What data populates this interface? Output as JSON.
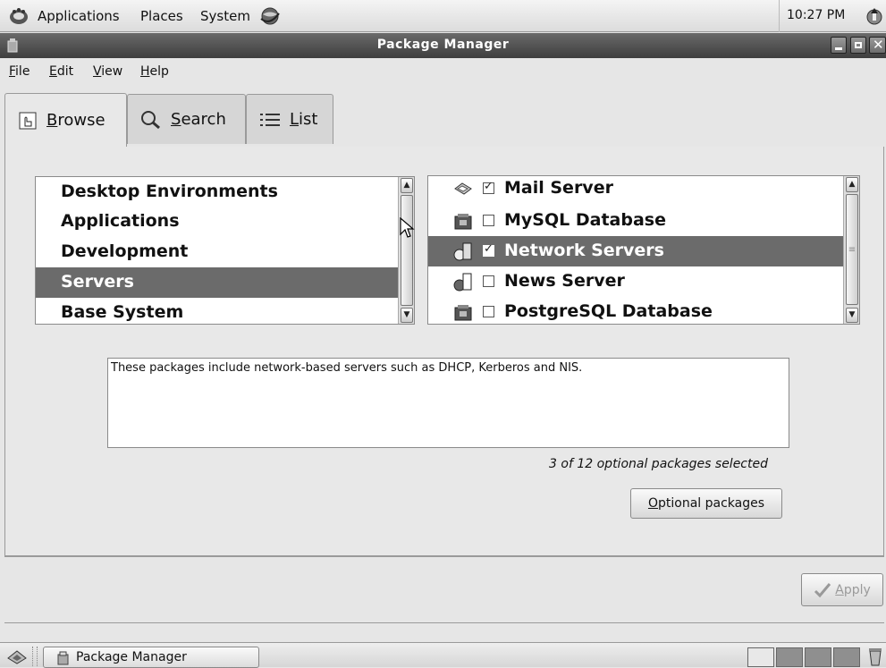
{
  "top_panel": {
    "menus": [
      "Applications",
      "Places",
      "System"
    ],
    "clock": "10:27 PM"
  },
  "window": {
    "title": "Package Manager"
  },
  "menubar": {
    "items": [
      {
        "accel": "F",
        "rest": "ile"
      },
      {
        "accel": "E",
        "rest": "dit"
      },
      {
        "accel": "V",
        "rest": "iew"
      },
      {
        "accel": "H",
        "rest": "elp"
      }
    ]
  },
  "tabs": [
    {
      "accel": "B",
      "rest": "rowse",
      "icon": "browse-icon",
      "active": true
    },
    {
      "accel": "S",
      "rest": "earch",
      "icon": "search-icon",
      "active": false
    },
    {
      "accel": "L",
      "rest": "ist",
      "icon": "list-icon",
      "active": false
    }
  ],
  "categories": {
    "items": [
      "Desktop Environments",
      "Applications",
      "Development",
      "Servers",
      "Base System"
    ],
    "selected_index": 3
  },
  "groups": {
    "items": [
      {
        "label": "Mail Server",
        "checked": true,
        "icon": "mail-server-icon"
      },
      {
        "label": "MySQL Database",
        "checked": false,
        "icon": "database-icon"
      },
      {
        "label": "Network Servers",
        "checked": true,
        "icon": "network-server-icon"
      },
      {
        "label": "News Server",
        "checked": false,
        "icon": "network-server-icon"
      },
      {
        "label": "PostgreSQL Database",
        "checked": false,
        "icon": "database-icon"
      }
    ],
    "selected_index": 2
  },
  "description": "These packages include network-based servers such as DHCP, Kerberos and NIS.",
  "selected_count": "3 of 12 optional packages selected",
  "buttons": {
    "optional_packages": {
      "accel": "O",
      "rest": "ptional packages"
    },
    "apply": {
      "accel": "A",
      "rest": "pply",
      "enabled": false
    }
  },
  "taskbar": {
    "task_label": "Package Manager",
    "workspaces": 4,
    "current_workspace": 0
  }
}
